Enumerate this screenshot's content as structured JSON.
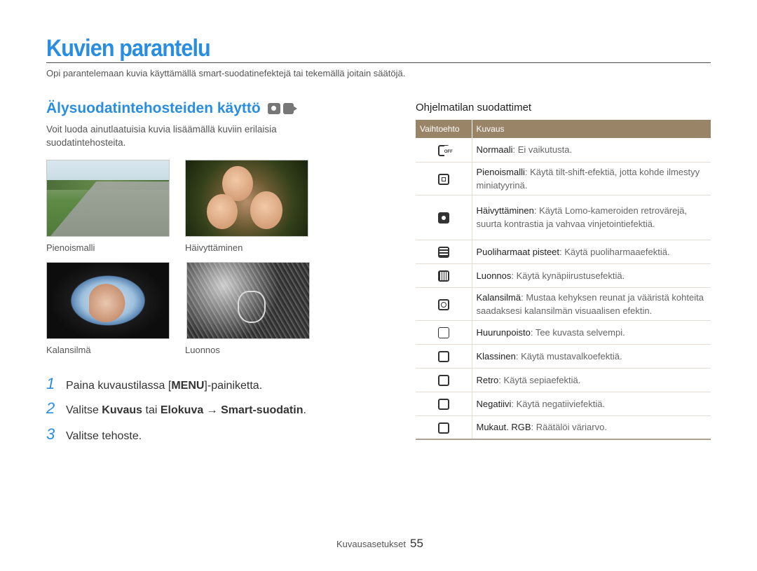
{
  "page": {
    "title": "Kuvien parantelu",
    "intro": "Opi parantelemaan kuvia käyttämällä smart-suodatinefektejä tai tekemällä joitain säätöjä."
  },
  "section": {
    "title": "Älysuodatintehosteiden käyttö",
    "mode_icons": [
      "camera-icon",
      "video-icon"
    ],
    "description": "Voit luoda ainutlaatuisia kuvia lisäämällä kuviin erilaisia suodatintehosteita."
  },
  "photos": [
    {
      "caption": "Pienoismalli"
    },
    {
      "caption": "Häivyttäminen"
    },
    {
      "caption": "Kalansilmä"
    },
    {
      "caption": "Luonnos"
    }
  ],
  "steps": [
    {
      "num": "1",
      "pre": "Paina kuvaustilassa [",
      "key": "MENU",
      "post": "]-painiketta."
    },
    {
      "num": "2",
      "pre": "Valitse ",
      "b1": "Kuvaus",
      "mid": " tai ",
      "b2": "Elokuva",
      "arrow": " → ",
      "b3": "Smart-suodatin",
      "post": "."
    },
    {
      "num": "3",
      "text": "Valitse tehoste."
    }
  ],
  "table": {
    "heading": "Ohjelmatilan suodattimet",
    "col_option": "Vaihtoehto",
    "col_description": "Kuvaus",
    "rows": [
      {
        "icon": "normal-filter-icon",
        "name": "Normaali",
        "desc": ": Ei vaikutusta."
      },
      {
        "icon": "miniature-filter-icon",
        "name": "Pienoismalli",
        "desc": ": Käytä tilt-shift-efektiä, jotta kohde ilmestyy miniatyyrinä."
      },
      {
        "icon": "vignette-filter-icon",
        "name": "Häivyttäminen",
        "desc": ": Käytä Lomo-kameroiden retrovärejä, suurta kontrastia ja vahvaa vinjetointiefektiä."
      },
      {
        "icon": "halftone-filter-icon",
        "name": "Puoliharmaat pisteet",
        "desc": ": Käytä puoliharmaaefektiä."
      },
      {
        "icon": "sketch-filter-icon",
        "name": "Luonnos",
        "desc": ": Käytä kynäpiirustusefektiä."
      },
      {
        "icon": "fisheye-filter-icon",
        "name": "Kalansilmä",
        "desc": ": Mustaa kehyksen reunat ja vääristä kohteita saadaksesi kalansilmän visuaalisen efektin."
      },
      {
        "icon": "defog-filter-icon",
        "name": "Huurunpoisto",
        "desc": ": Tee kuvasta selvempi."
      },
      {
        "icon": "classic-filter-icon",
        "name": "Klassinen",
        "desc": ": Käytä mustavalkoefektiä."
      },
      {
        "icon": "retro-filter-icon",
        "name": "Retro",
        "desc": ": Käytä sepiaefektiä."
      },
      {
        "icon": "negative-filter-icon",
        "name": "Negatiivi",
        "desc": ": Käytä negatiiviefektiä."
      },
      {
        "icon": "custom-rgb-filter-icon",
        "name": "Mukaut. RGB",
        "desc": ": Räätälöi väriarvo."
      }
    ]
  },
  "footer": {
    "label": "Kuvausasetukset",
    "page_number": "55"
  },
  "colors": {
    "accent": "#2a8ee0",
    "table_header": "#9a8468"
  }
}
